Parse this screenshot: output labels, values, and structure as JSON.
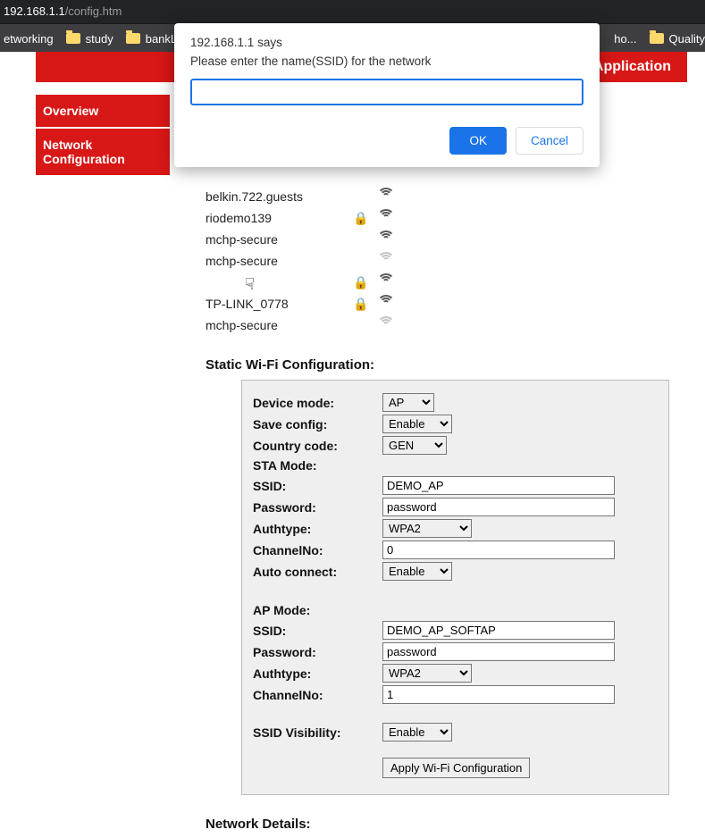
{
  "address": {
    "host": "192.168.1.1",
    "path": "/config.htm"
  },
  "bookmarks": [
    {
      "label": "etworking"
    },
    {
      "label": "study"
    },
    {
      "label": "bankL"
    },
    {
      "label": "ho..."
    },
    {
      "label": "Quality"
    }
  ],
  "prompt": {
    "origin_says": "192.168.1.1 says",
    "message": "Please enter the name(SSID) for the network",
    "value": "",
    "ok_label": "OK",
    "cancel_label": "Cancel"
  },
  "header": {
    "title_suffix": "emo Application"
  },
  "sidebar": {
    "items": [
      {
        "label": "Overview"
      },
      {
        "label": "Network Configuration"
      }
    ]
  },
  "networks": [
    {
      "ssid": "belkin.722.guests",
      "locked": false,
      "signal": "strong"
    },
    {
      "ssid": "riodemo139",
      "locked": true,
      "signal": "strong"
    },
    {
      "ssid": "mchp-secure",
      "locked": false,
      "signal": "strong"
    },
    {
      "ssid": "mchp-secure",
      "locked": false,
      "signal": "weak"
    },
    {
      "ssid": "",
      "locked": true,
      "signal": "strong"
    },
    {
      "ssid": "TP-LINK_0778",
      "locked": true,
      "signal": "strong"
    },
    {
      "ssid": "mchp-secure",
      "locked": false,
      "signal": "weak"
    }
  ],
  "sections": {
    "static_cfg_title": "Static Wi-Fi Configuration:",
    "network_details_title": "Network Details:"
  },
  "cfg": {
    "labels": {
      "device_mode": "Device mode:",
      "save_config": "Save config:",
      "country_code": "Country code:",
      "sta_mode": "STA Mode:",
      "ssid": "SSID:",
      "password": "Password:",
      "authtype": "Authtype:",
      "channelno": "ChannelNo:",
      "auto_connect": "Auto connect:",
      "ap_mode": "AP Mode:",
      "ssid_visibility": "SSID Visibility:",
      "apply": "Apply Wi-Fi Configuration"
    },
    "device_mode": {
      "options": [
        "AP"
      ],
      "value": "AP"
    },
    "save_config": {
      "options": [
        "Enable"
      ],
      "value": "Enable"
    },
    "country_code": {
      "options": [
        "GEN"
      ],
      "value": "GEN"
    },
    "sta": {
      "ssid": "DEMO_AP",
      "password": "password",
      "authtype": {
        "options": [
          "WPA2"
        ],
        "value": "WPA2"
      },
      "channel": "0",
      "auto_connect": {
        "options": [
          "Enable"
        ],
        "value": "Enable"
      }
    },
    "ap": {
      "ssid": "DEMO_AP_SOFTAP",
      "password": "password",
      "authtype": {
        "options": [
          "WPA2"
        ],
        "value": "WPA2"
      },
      "channel": "1",
      "ssid_visibility": {
        "options": [
          "Enable"
        ],
        "value": "Enable"
      }
    }
  }
}
